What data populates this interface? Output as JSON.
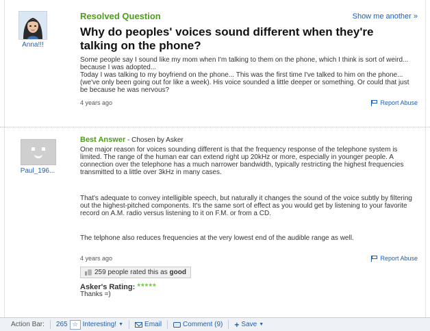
{
  "question": {
    "section_label": "Resolved Question",
    "show_another": "Show me another »",
    "asker_name": "Anna!!!",
    "title": "Why do peoples' voices sound different when they're talking on the phone?",
    "body": "Some people say I sound like my mom when I'm talking to them on the phone, which I think is sort of weird... because I was adopted...\nToday I was talking to my boyfriend on the phone... This was the first time I've talked to him on the phone... (we've only been going out for like a week). His voice sounded a little deeper or something. Or could that just be because he was nervous?",
    "time": "4 years ago",
    "report": "Report Abuse"
  },
  "answer": {
    "label": "Best Answer",
    "chosen_by": " - Chosen by Asker",
    "answerer_name": "Paul_196...",
    "paragraphs": [
      "One major reason for voices sounding different is that the frequency response of the telephone system is limited. The range of the human ear can extend right up 20kHz or more, especially in younger people. A connection over the telephone has a much narrower bandwidth, typically restricting the highest frequencies transmitted to a little over 3kHz in many cases.",
      "That's adequate to convey intelligible speech, but naturally it changes the sound of the voice subtly by filtering out the highest-pitched components. It's the same sort of effect as you would get by listening to your favorite record on A.M. radio versus listening to it on F.M. or from a CD.",
      "The telphone also reduces frequencies at the very lowest end of the audible range as well."
    ],
    "time": "4 years ago",
    "report": "Report Abuse",
    "rated_prefix": "259 people rated this as ",
    "rated_word": "good",
    "asker_rating_label": "Asker's Rating:",
    "stars": "*****",
    "rating_stars": 5,
    "thanks": "Thanks =)"
  },
  "action_bar": {
    "label": "Action Bar:",
    "interesting_count": "265",
    "interesting": "Interesting!",
    "email": "Email",
    "comment": "Comment (9)",
    "save": "Save"
  },
  "colors": {
    "link": "#1e5fb4",
    "green": "#4d9d1a",
    "star": "#6ad12a"
  }
}
